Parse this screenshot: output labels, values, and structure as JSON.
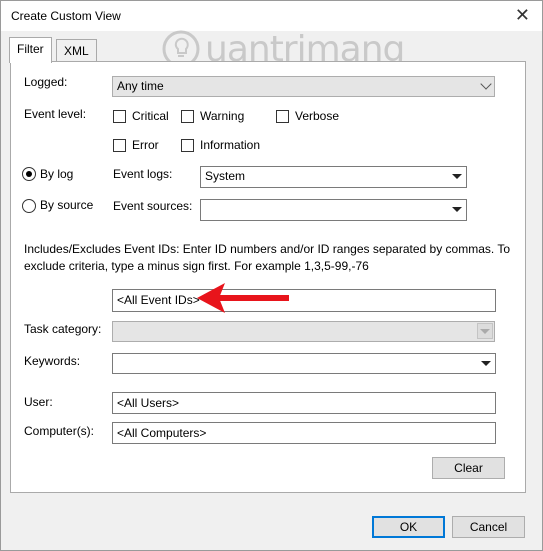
{
  "window": {
    "title": "Create Custom View"
  },
  "tabs": [
    {
      "label": "Filter",
      "active": true
    },
    {
      "label": "XML",
      "active": false
    }
  ],
  "watermark": {
    "text": "uantrimang"
  },
  "logged": {
    "label": "Logged:",
    "value": "Any time"
  },
  "event_level": {
    "label": "Event level:",
    "options": [
      {
        "label": "Critical",
        "checked": false
      },
      {
        "label": "Warning",
        "checked": false
      },
      {
        "label": "Verbose",
        "checked": false
      },
      {
        "label": "Error",
        "checked": false
      },
      {
        "label": "Information",
        "checked": false
      }
    ]
  },
  "by_log": {
    "label": "By log",
    "selected": true
  },
  "by_source": {
    "label": "By source",
    "selected": false
  },
  "event_logs": {
    "label": "Event logs:",
    "value": "System"
  },
  "event_sources": {
    "label": "Event sources:",
    "value": ""
  },
  "description": "Includes/Excludes Event IDs: Enter ID numbers and/or ID ranges separated by commas. To exclude criteria, type a minus sign first. For example 1,3,5-99,-76",
  "event_ids": {
    "value": "<All Event IDs>"
  },
  "task_category": {
    "label": "Task category:",
    "value": ""
  },
  "keywords": {
    "label": "Keywords:",
    "value": ""
  },
  "user": {
    "label": "User:",
    "value": "<All Users>"
  },
  "computer": {
    "label": "Computer(s):",
    "value": "<All Computers>"
  },
  "buttons": {
    "clear": "Clear",
    "ok": "OK",
    "cancel": "Cancel"
  },
  "colors": {
    "arrow": "#e8141b",
    "accent": "#0078d7",
    "watermark": "#c9c9c9"
  }
}
